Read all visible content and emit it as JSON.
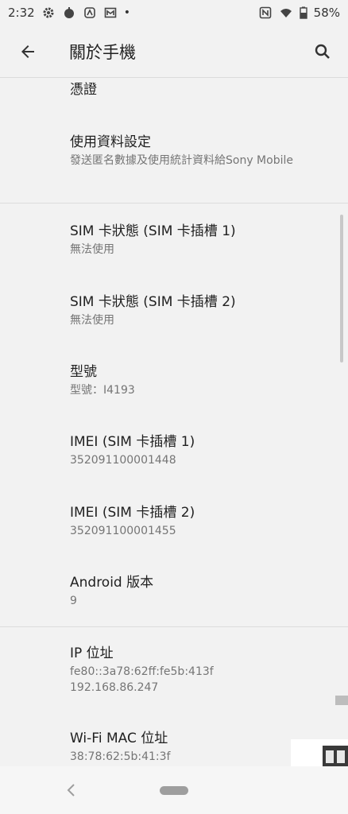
{
  "status_bar": {
    "time": "2:32",
    "battery": "58%",
    "dot": "•"
  },
  "app_bar": {
    "title": "關於手機"
  },
  "items": [
    {
      "title": "憑證",
      "summary": ""
    },
    {
      "title": "使用資料設定",
      "summary": "發送匿名數據及使用統計資料給Sony Mobile"
    },
    {
      "title": "SIM 卡狀態 (SIM 卡插槽 1)",
      "summary": "無法使用"
    },
    {
      "title": "SIM 卡狀態 (SIM 卡插槽 2)",
      "summary": "無法使用"
    },
    {
      "title": "型號",
      "summary": "型號：I4193"
    },
    {
      "title": "IMEI (SIM 卡插槽 1)",
      "summary": "352091100001448"
    },
    {
      "title": "IMEI (SIM 卡插槽 2)",
      "summary": "352091100001455"
    },
    {
      "title": "Android 版本",
      "summary": "9"
    },
    {
      "title": "IP 位址",
      "summary_lines": [
        "fe80::3a78:62ff:fe5b:413f",
        "192.168.86.247"
      ]
    },
    {
      "title": "Wi-Fi MAC 位址",
      "summary": "38:78:62:5b:41:3f"
    }
  ],
  "icons": {
    "status": [
      "settings-icon",
      "circle-icon",
      "app-icon",
      "mail-icon"
    ],
    "right": [
      "nfc-icon",
      "wifi-icon",
      "battery-icon"
    ]
  }
}
